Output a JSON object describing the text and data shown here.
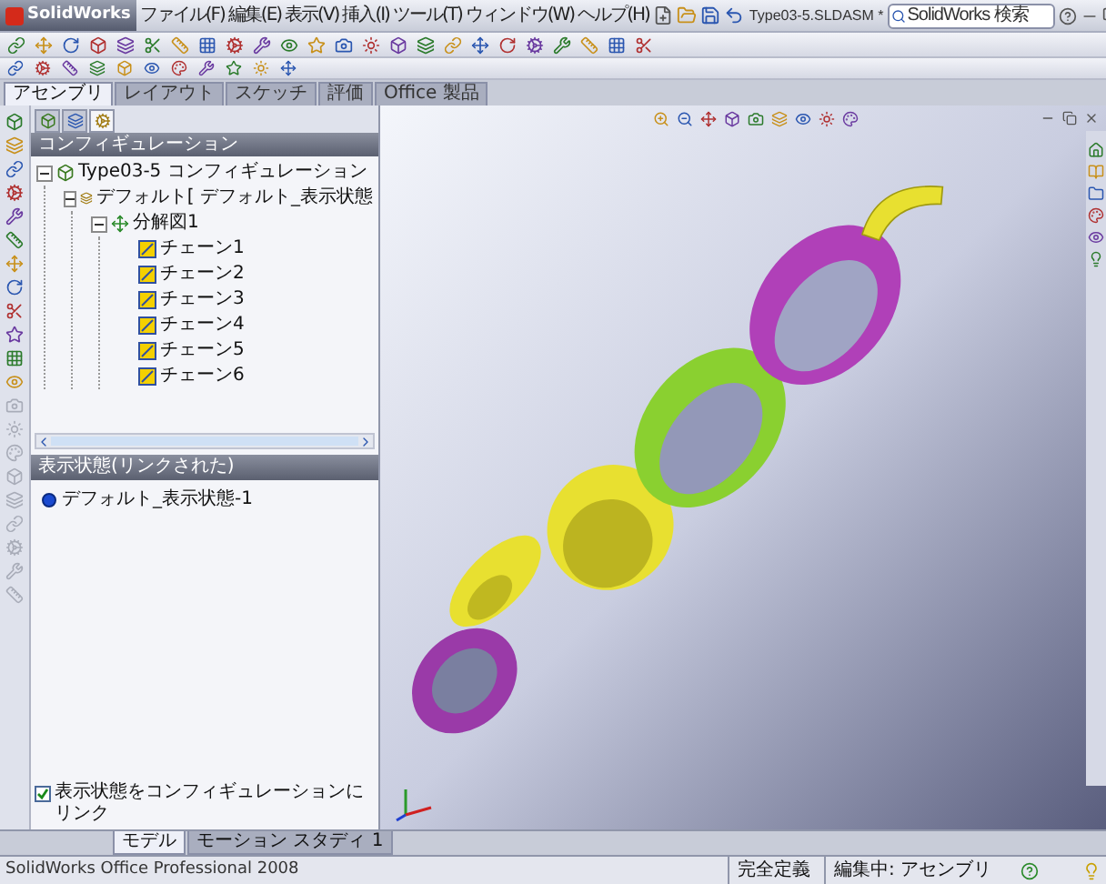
{
  "app": {
    "logo": "SolidWorks"
  },
  "menu": [
    "ファイル(F)",
    "編集(E)",
    "表示(V)",
    "挿入(I)",
    "ツール(T)",
    "ウィンドウ(W)",
    "ヘルプ(H)"
  ],
  "document_title": "Type03-5.SLDASM *",
  "search": {
    "placeholder": "SolidWorks 検索"
  },
  "command_tabs": [
    {
      "label": "アセンブリ",
      "selected": true
    },
    {
      "label": "レイアウト",
      "selected": false
    },
    {
      "label": "スケッチ",
      "selected": false
    },
    {
      "label": "評価",
      "selected": false
    },
    {
      "label": "Office 製品",
      "selected": false
    }
  ],
  "config_panel": {
    "tabs": [
      {
        "kind": "feature",
        "selected": false
      },
      {
        "kind": "property",
        "selected": false
      },
      {
        "kind": "config",
        "selected": true
      }
    ],
    "title": "コンフィギュレーション",
    "tree": [
      {
        "label": "Type03-5 コンフィギュレーション",
        "kind": "assembly",
        "expanded": true,
        "children": [
          {
            "label": "デフォルト[ デフォルト_表示状態",
            "kind": "config",
            "expanded": true,
            "children": [
              {
                "label": "分解図1",
                "kind": "explode",
                "expanded": true,
                "children": [
                  {
                    "label": "チェーン1",
                    "kind": "step"
                  },
                  {
                    "label": "チェーン2",
                    "kind": "step"
                  },
                  {
                    "label": "チェーン3",
                    "kind": "step"
                  },
                  {
                    "label": "チェーン4",
                    "kind": "step"
                  },
                  {
                    "label": "チェーン5",
                    "kind": "step"
                  },
                  {
                    "label": "チェーン6",
                    "kind": "step"
                  }
                ]
              }
            ]
          }
        ]
      }
    ]
  },
  "display_states": {
    "title": "表示状態(リンクされた)",
    "items": [
      {
        "label": "デフォルト_表示状態-1"
      }
    ]
  },
  "link_checkbox": {
    "label": "表示状態をコンフィギュレーションにリンク",
    "checked": true
  },
  "bottom_tabs": [
    {
      "label": "モデル",
      "selected": true
    },
    {
      "label": "モーション スタディ 1",
      "selected": false
    }
  ],
  "status_bar": {
    "product": "SolidWorks Office Professional 2008",
    "sections": [
      "完全定義",
      "編集中: アセンブリ"
    ]
  }
}
